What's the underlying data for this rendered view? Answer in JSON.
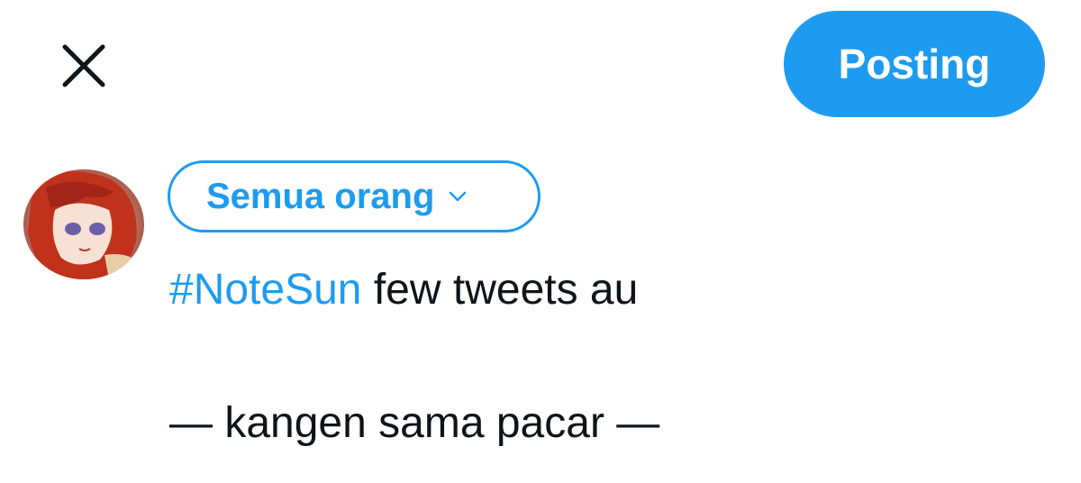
{
  "header": {
    "close_icon": "close-icon",
    "post_label": "Posting"
  },
  "composer": {
    "audience_label": "Semua orang",
    "audience_icon": "chevron-down-icon",
    "hashtag": "#NoteSun",
    "line1_text": " few tweets au",
    "line2_text": "— kangen sama pacar —"
  },
  "colors": {
    "accent": "#1d9bf0",
    "text": "#0f1419"
  }
}
